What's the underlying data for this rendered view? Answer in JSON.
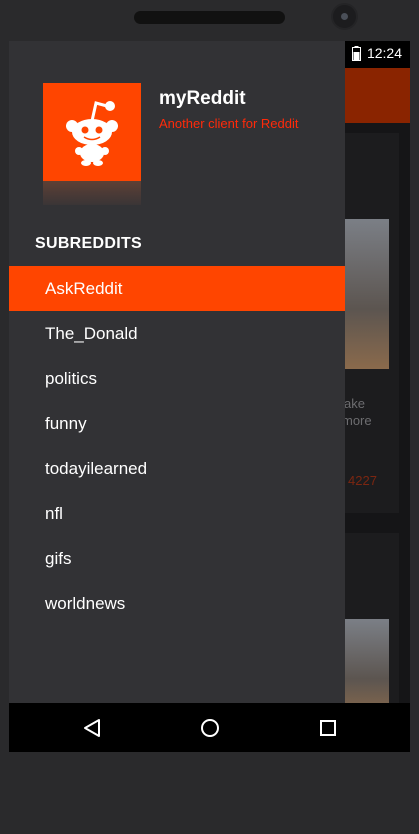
{
  "status_bar": {
    "time": "12:24"
  },
  "drawer": {
    "app_name": "myReddit",
    "tagline": "Another client for Reddit",
    "section_title": "SUBREDDITS",
    "subreddits": [
      {
        "label": "AskReddit",
        "active": true
      },
      {
        "label": "The_Donald",
        "active": false
      },
      {
        "label": "politics",
        "active": false
      },
      {
        "label": "funny",
        "active": false
      },
      {
        "label": "todayilearned",
        "active": false
      },
      {
        "label": "nfl",
        "active": false
      },
      {
        "label": "gifs",
        "active": false
      },
      {
        "label": "worldnews",
        "active": false
      }
    ]
  },
  "background_feed": {
    "partial_text_line1": "ake",
    "partial_text_line2": "more",
    "partial_count": "4227"
  },
  "colors": {
    "accent": "#ff4500",
    "drawer_bg": "#323235",
    "tagline": "#ff2a0a"
  },
  "icons": {
    "wifi": "wifi-icon",
    "signal": "signal-icon",
    "battery": "battery-icon",
    "logo": "reddit-alien-icon",
    "back": "back-triangle-icon",
    "home": "home-circle-icon",
    "recents": "recents-square-icon"
  }
}
